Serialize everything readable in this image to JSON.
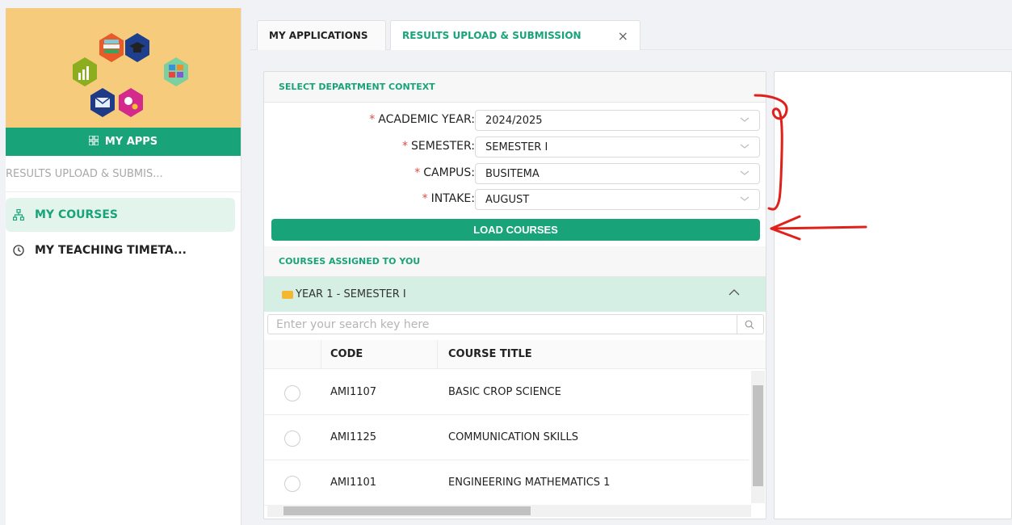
{
  "sidebar": {
    "myapps_label": "MY APPS",
    "crumb": "RESULTS UPLOAD & SUBMIS...",
    "items": [
      {
        "label": "MY COURSES",
        "icon": "sitemap-icon",
        "active": true
      },
      {
        "label": "MY TEACHING TIMETA...",
        "icon": "clock-icon",
        "active": false
      }
    ]
  },
  "tabs": [
    {
      "label": "MY APPLICATIONS"
    },
    {
      "label": "RESULTS UPLOAD & SUBMISSION",
      "close": "×"
    }
  ],
  "context": {
    "header": "SELECT DEPARTMENT CONTEXT",
    "fields": [
      {
        "label": "ACADEMIC YEAR:",
        "value": "2024/2025"
      },
      {
        "label": "SEMESTER:",
        "value": "SEMESTER I"
      },
      {
        "label": "CAMPUS:",
        "value": "BUSITEMA"
      },
      {
        "label": "INTAKE:",
        "value": "AUGUST"
      }
    ],
    "required_mark": "*",
    "load_button": "LOAD COURSES"
  },
  "courses": {
    "header": "COURSES ASSIGNED TO YOU",
    "group": "YEAR 1 - SEMESTER I",
    "search_placeholder": "Enter your search key here",
    "columns": {
      "code": "CODE",
      "title": "COURSE TITLE"
    },
    "rows": [
      {
        "code": "AMI1107",
        "title": "BASIC CROP SCIENCE"
      },
      {
        "code": "AMI1125",
        "title": "COMMUNICATION SKILLS"
      },
      {
        "code": "AMI1101",
        "title": "ENGINEERING MATHEMATICS 1"
      }
    ]
  },
  "colors": {
    "accent": "#18a478",
    "logo_bg": "#f6cc7c",
    "annotation": "#e0201b"
  }
}
